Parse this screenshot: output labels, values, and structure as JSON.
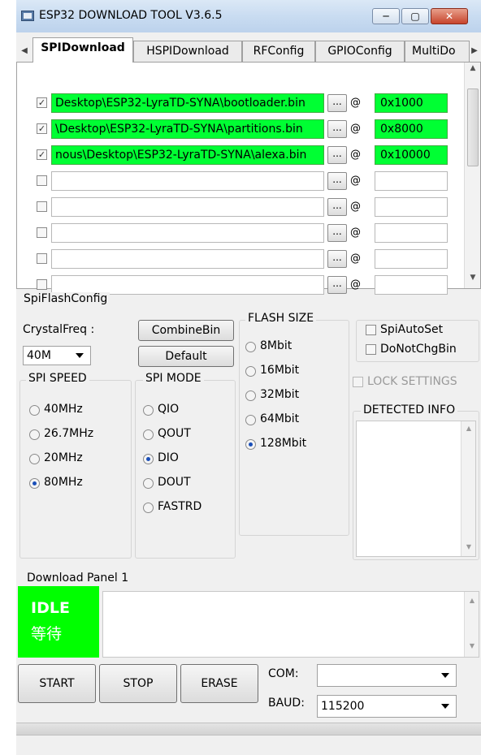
{
  "window": {
    "title": "ESP32 DOWNLOAD TOOL V3.6.5",
    "controls": [
      "─",
      "▢",
      "✕"
    ]
  },
  "tabs": {
    "items": [
      {
        "label": "SPIDownload"
      },
      {
        "label": "HSPIDownload"
      },
      {
        "label": "RFConfig"
      },
      {
        "label": "GPIOConfig"
      },
      {
        "label": "MultiDo"
      }
    ],
    "active": "SPIDownload"
  },
  "files": {
    "rows": [
      {
        "checked": true,
        "path": "Desktop\\ESP32-LyraTD-SYNA\\bootloader.bin",
        "browse": "...",
        "at": "@",
        "address": "0x1000"
      },
      {
        "checked": true,
        "path": "\\Desktop\\ESP32-LyraTD-SYNA\\partitions.bin",
        "browse": "...",
        "at": "@",
        "address": "0x8000"
      },
      {
        "checked": true,
        "path": "nous\\Desktop\\ESP32-LyraTD-SYNA\\alexa.bin",
        "browse": "...",
        "at": "@",
        "address": "0x10000"
      },
      {
        "checked": false,
        "path": "",
        "browse": "...",
        "at": "@",
        "address": ""
      },
      {
        "checked": false,
        "path": "",
        "browse": "...",
        "at": "@",
        "address": ""
      },
      {
        "checked": false,
        "path": "",
        "browse": "...",
        "at": "@",
        "address": ""
      },
      {
        "checked": false,
        "path": "",
        "browse": "...",
        "at": "@",
        "address": ""
      },
      {
        "checked": false,
        "path": "",
        "browse": "...",
        "at": "@",
        "address": ""
      }
    ]
  },
  "spiflash": {
    "title": "SpiFlashConfig",
    "crystal_label": "CrystalFreq :",
    "crystal_value": "40M",
    "combine_label": "CombineBin",
    "default_label": "Default",
    "spi_speed": {
      "title": "SPI SPEED",
      "options": [
        "40MHz",
        "26.7MHz",
        "20MHz",
        "80MHz"
      ],
      "selected": "80MHz"
    },
    "spi_mode": {
      "title": "SPI MODE",
      "options": [
        "QIO",
        "QOUT",
        "DIO",
        "DOUT",
        "FASTRD"
      ],
      "selected": "DIO"
    },
    "flash_size": {
      "title": "FLASH SIZE",
      "options": [
        "8Mbit",
        "16Mbit",
        "32Mbit",
        "64Mbit",
        "128Mbit"
      ],
      "selected": "128Mbit"
    },
    "spi_auto_set": {
      "label": "SpiAutoSet",
      "checked": false
    },
    "do_not_chg_bin": {
      "label": "DoNotChgBin",
      "checked": false
    },
    "lock_settings": {
      "label": "LOCK SETTINGS",
      "checked": false
    },
    "detected_info": {
      "title": "DETECTED INFO",
      "content": ""
    }
  },
  "download": {
    "title": "Download Panel 1",
    "status_line1": "IDLE",
    "status_line2": "等待",
    "status_color": "#00ff00",
    "log": "",
    "start_label": "START",
    "stop_label": "STOP",
    "erase_label": "ERASE",
    "com_label": "COM:",
    "com_value": "",
    "baud_label": "BAUD:",
    "baud_value": "115200"
  },
  "colors": {
    "accent_green": "#00ff33",
    "status_green": "#00ff00"
  }
}
